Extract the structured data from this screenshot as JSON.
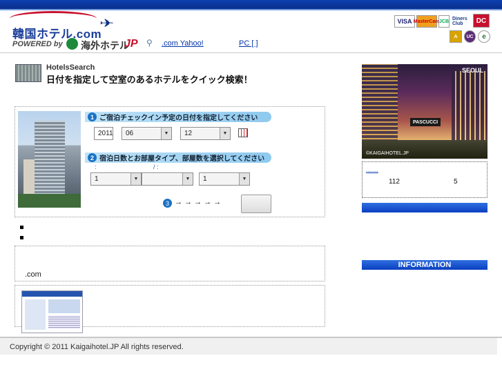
{
  "header": {
    "logo_text": "韓国ホテル.com",
    "powered_by": "POWERED by",
    "kaigai_text": "海外ホテル",
    "kaigai_jp": "JP",
    "link_yahoo": ".com  Yahoo!",
    "link_pc": "PC [    ]",
    "cards": {
      "visa": "VISA",
      "master": "MasterCard",
      "jcb": "JCB",
      "diners": "Diners Club",
      "dc": "DC",
      "uc": "UC"
    }
  },
  "search": {
    "title_en": "HotelsSearch",
    "title_jp": "日付を指定して空室のあるホテルをクイック検索！",
    "step1_num": "1",
    "step1_label": "ご宿泊チェックイン予定の日付を指定してください",
    "year": "2011",
    "month": "06",
    "day": "12",
    "step2_num": "2",
    "step2_label": "宿泊日数とお部屋タイプ、部屋数を選択してください",
    "hint_left": ":",
    "hint_right": "/ :",
    "nights": "1",
    "room_type": "",
    "rooms": "1",
    "step3_num": "3",
    "step3_arrows": "→ → → → →",
    "search_button": ""
  },
  "list": {
    "link1a": "   ",
    "link1b": "   ",
    "link2": "                    "
  },
  "info_box": {
    "text": ".com"
  },
  "promo": {
    "link1": "     ",
    "link2": "   "
  },
  "sidebar": {
    "photo_title": "SEOUL",
    "photo_sign": "PASCUCCI",
    "photo_watermark": "©KAIGAIHOTEL.JP",
    "count_link": "........",
    "count_number": "112",
    "count_link2": "   ",
    "count_five": "5",
    "bar1": "",
    "link1": "     ",
    "link2": "     ",
    "link3": "     ",
    "info_bar": "INFORMATION",
    "info_link": "  "
  },
  "footer": {
    "copyright": "Copyright © 2011 Kaigaihotel.JP All rights reserved."
  },
  "colors": {
    "brand_blue": "#0a3fc0",
    "brand_red": "#c8102e",
    "link_blue": "#0033aa"
  },
  "icons": {
    "plane": "plane-icon",
    "calendar": "calendar-icon",
    "search": "search-icon",
    "link": "link-icon"
  }
}
